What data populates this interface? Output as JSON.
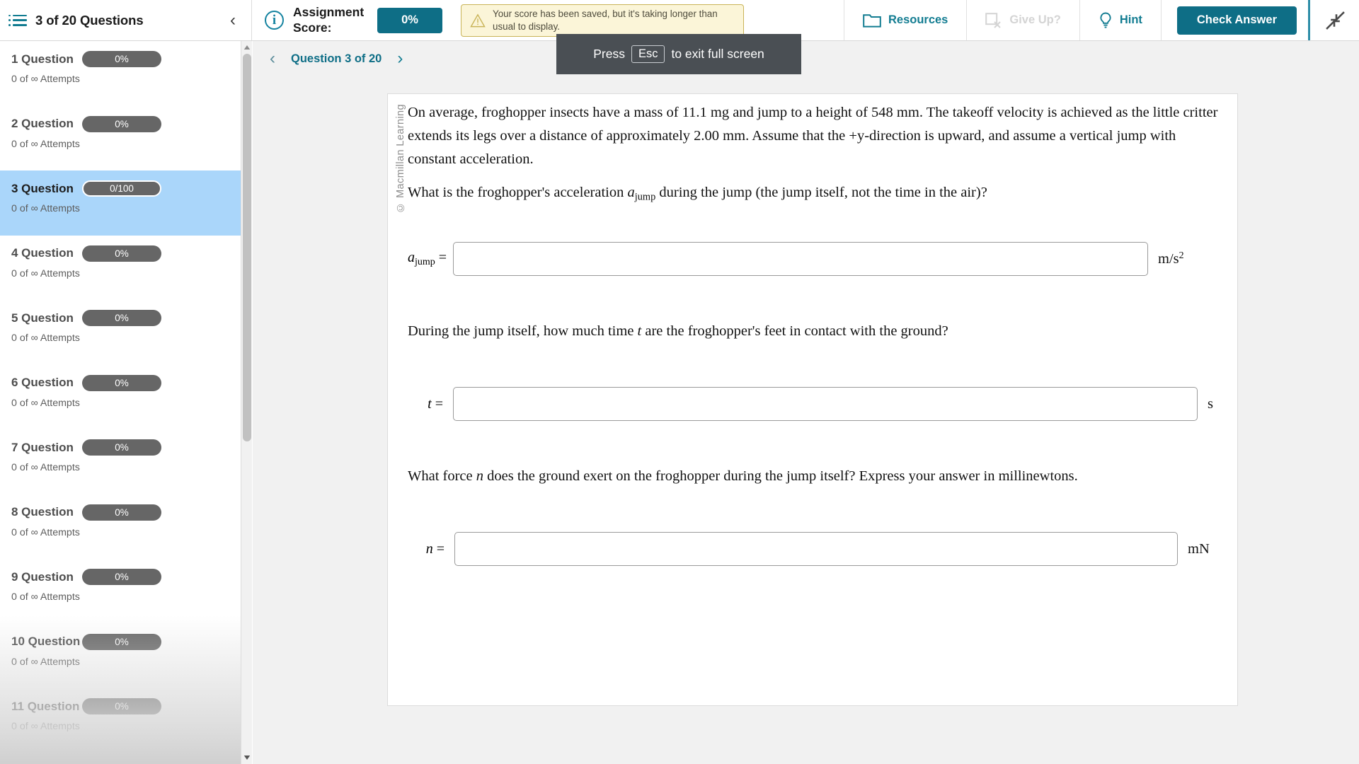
{
  "topbar": {
    "question_count_label": "3 of 20 Questions",
    "collapse_chevron": "‹",
    "assignment_score_label": "Assignment Score:",
    "assignment_score_value": "0%",
    "warning_text": "Your score has been saved, but it's taking longer than usual to display.",
    "resources_label": "Resources",
    "give_up_label": "Give Up?",
    "hint_label": "Hint",
    "check_answer_label": "Check Answer",
    "accent_color": "#0e6e86",
    "warning_bg": "#fbf5d8",
    "warning_border": "#c9b458"
  },
  "fullscreen_toast": {
    "prefix": "Press",
    "key": "Esc",
    "suffix": "to exit full screen"
  },
  "sidebar": {
    "questions": [
      {
        "title": "1 Question",
        "badge": "0%",
        "attempts": "0 of ∞ Attempts",
        "active": false
      },
      {
        "title": "2 Question",
        "badge": "0%",
        "attempts": "0 of ∞ Attempts",
        "active": false
      },
      {
        "title": "3 Question",
        "badge": "0/100",
        "attempts": "0 of ∞ Attempts",
        "active": true
      },
      {
        "title": "4 Question",
        "badge": "0%",
        "attempts": "0 of ∞ Attempts",
        "active": false
      },
      {
        "title": "5 Question",
        "badge": "0%",
        "attempts": "0 of ∞ Attempts",
        "active": false
      },
      {
        "title": "6 Question",
        "badge": "0%",
        "attempts": "0 of ∞ Attempts",
        "active": false
      },
      {
        "title": "7 Question",
        "badge": "0%",
        "attempts": "0 of ∞ Attempts",
        "active": false
      },
      {
        "title": "8 Question",
        "badge": "0%",
        "attempts": "0 of ∞ Attempts",
        "active": false
      },
      {
        "title": "9 Question",
        "badge": "0%",
        "attempts": "0 of ∞ Attempts",
        "active": false
      },
      {
        "title": "10 Question",
        "badge": "0%",
        "attempts": "0 of ∞ Attempts",
        "active": false
      },
      {
        "title": "11 Question",
        "badge": "0%",
        "attempts": "0 of ∞ Attempts",
        "active": false
      }
    ],
    "active_highlight_color": "#aad6fa",
    "badge_color": "#666666"
  },
  "question_nav": {
    "prev_arrow": "‹",
    "title": "Question 3 of 20",
    "next_arrow": "›"
  },
  "question": {
    "watermark": "© Macmillan Learning",
    "paragraph_1": "On average, froghopper insects have a mass of 11.1 mg and jump to a height of 548 mm. The takeoff velocity is achieved as the little critter extends its legs over a distance of approximately 2.00 mm. Assume that the +y-direction is upward, and assume a vertical jump with constant acceleration.",
    "part_a_prompt_pre": "What is the froghopper's acceleration ",
    "part_a_symbol_base": "a",
    "part_a_symbol_sub": "jump",
    "part_a_prompt_post": " during the jump (the jump itself, not the time in the air)?",
    "part_b_prompt_pre": "During the jump itself, how much time ",
    "part_b_symbol": "t",
    "part_b_prompt_post": " are the froghopper's feet in contact with the ground?",
    "part_c_prompt_pre": "What force ",
    "part_c_symbol": "n",
    "part_c_prompt_post": " does the ground exert on the froghopper during the jump itself? Express your answer in millinewtons.",
    "answers": [
      {
        "label_base": "a",
        "label_sub": "jump",
        "equals": "=",
        "value": "",
        "unit_base": "m/s",
        "unit_sup": "2"
      },
      {
        "label_base": "t",
        "label_sub": "",
        "equals": "=",
        "value": "",
        "unit_base": "s",
        "unit_sup": ""
      },
      {
        "label_base": "n",
        "label_sub": "",
        "equals": "=",
        "value": "",
        "unit_base": "mN",
        "unit_sup": ""
      }
    ]
  }
}
